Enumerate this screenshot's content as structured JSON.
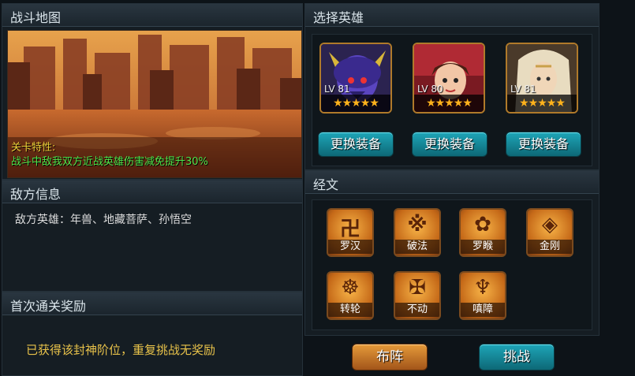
{
  "left": {
    "map_title": "战斗地图",
    "trait_title": "关卡特性:",
    "trait_text": "战斗中敌我双方近战英雄伤害减免提升30%",
    "enemy_title": "敌方信息",
    "enemy_text": "敌方英雄：年兽、地藏菩萨、孙悟空",
    "reward_title": "首次通关奖励",
    "reward_text": "已获得该封神阶位，重复挑战无奖励"
  },
  "heroes": {
    "title": "选择英雄",
    "items": [
      {
        "level": "LV 81",
        "stars": "★★★★★",
        "equip_label": "更换装备"
      },
      {
        "level": "LV 80",
        "stars": "★★★★★",
        "equip_label": "更换装备"
      },
      {
        "level": "LV 81",
        "stars": "★★★★★",
        "equip_label": "更换装备"
      }
    ]
  },
  "scriptures": {
    "title": "经文",
    "items": [
      {
        "name": "罗汉",
        "icon": "arhat-glyph-icon"
      },
      {
        "name": "破法",
        "icon": "break-dharma-glyph-icon"
      },
      {
        "name": "罗睺",
        "icon": "rahu-glyph-icon"
      },
      {
        "name": "金刚",
        "icon": "vajra-glyph-icon"
      },
      {
        "name": "转轮",
        "icon": "wheel-glyph-icon"
      },
      {
        "name": "不动",
        "icon": "immovable-glyph-icon"
      },
      {
        "name": "嗔障",
        "icon": "wrath-glyph-icon"
      }
    ]
  },
  "actions": {
    "formation_label": "布阵",
    "challenge_label": "挑战"
  },
  "colors": {
    "trait_title": "#f0d23a",
    "trait_text": "#4fe34a",
    "reward_text": "#e8c24a",
    "teal_button": "#1ea5b8",
    "orange_button": "#e59a3a",
    "star": "#ffb21c"
  }
}
